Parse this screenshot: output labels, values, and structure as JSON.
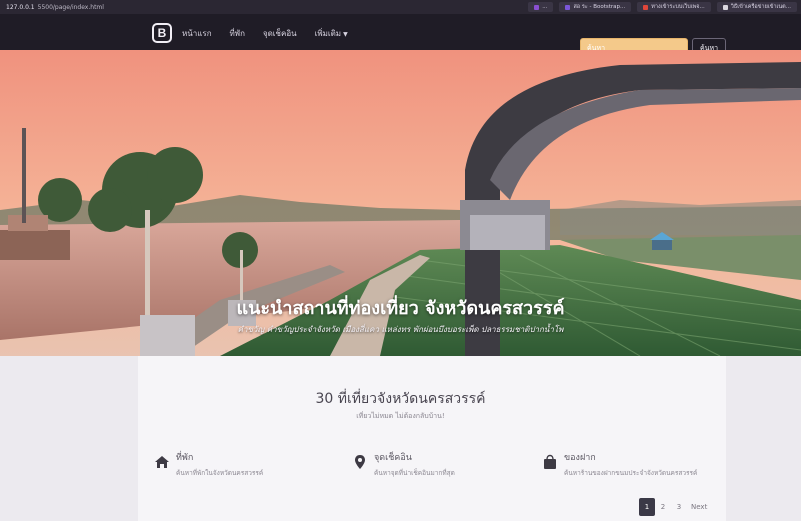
{
  "browser": {
    "url": "127.0.0.1",
    "url_rest": "5500/page/index.html",
    "tabs": [
      {
        "label": "...",
        "color": "#8a4fd1"
      },
      {
        "label": "สอ ระ - Bootstrap...",
        "color": "#7b56d8"
      },
      {
        "label": "ทางเข้าระบบเว็บเพจ...",
        "color": "#e0463a"
      },
      {
        "label": "วิธีเข้าเครือข่ายเข้าเนต...",
        "color": "#d9d6de"
      }
    ]
  },
  "navbar": {
    "brand": "B",
    "links": [
      "หน้าแรก",
      "ที่พัก",
      "จุดเช็คอิน",
      "เพิ่มเติม"
    ],
    "search_placeholder": "ค้นหา",
    "search_button": "ค้นหา"
  },
  "hero": {
    "title": "แนะนำสถานที่ท่องเที่ยว จังหวัดนครสวรรค์",
    "subtitle": "คำขวัญ คำขวัญประจำจังหวัด เมืองสี่แคว แหล่งทร พักผ่อนบึงบอระเพ็ด ปลาธรรมชาติปากน้ำโพ"
  },
  "section": {
    "title": "30 ที่เที่ยวจังหวัดนครสวรรค์",
    "subtitle": "เที่ยวไม่หมด ไม่ต้องกลับบ้าน!"
  },
  "features": [
    {
      "icon": "home-icon",
      "title": "ที่พัก",
      "desc": "ค้นหาที่พักในจังหวัดนครสวรรค์"
    },
    {
      "icon": "map-pin-icon",
      "title": "จุดเช็คอิน",
      "desc": "ค้นหาจุดที่น่าเช็คอินมากที่สุด"
    },
    {
      "icon": "shopping-bag-icon",
      "title": "ของฝาก",
      "desc": "ค้นหาร้านของฝากขนมประจำจังหวัดนครสวรรค์"
    }
  ],
  "pagination": {
    "pages": [
      "1",
      "2",
      "3"
    ],
    "active": "1",
    "next": "Next"
  },
  "colors": {
    "navbar": "#1f1c26",
    "search": "#f4c98a",
    "sky_top": "#f09a84",
    "grass": "#3e6b3c"
  }
}
